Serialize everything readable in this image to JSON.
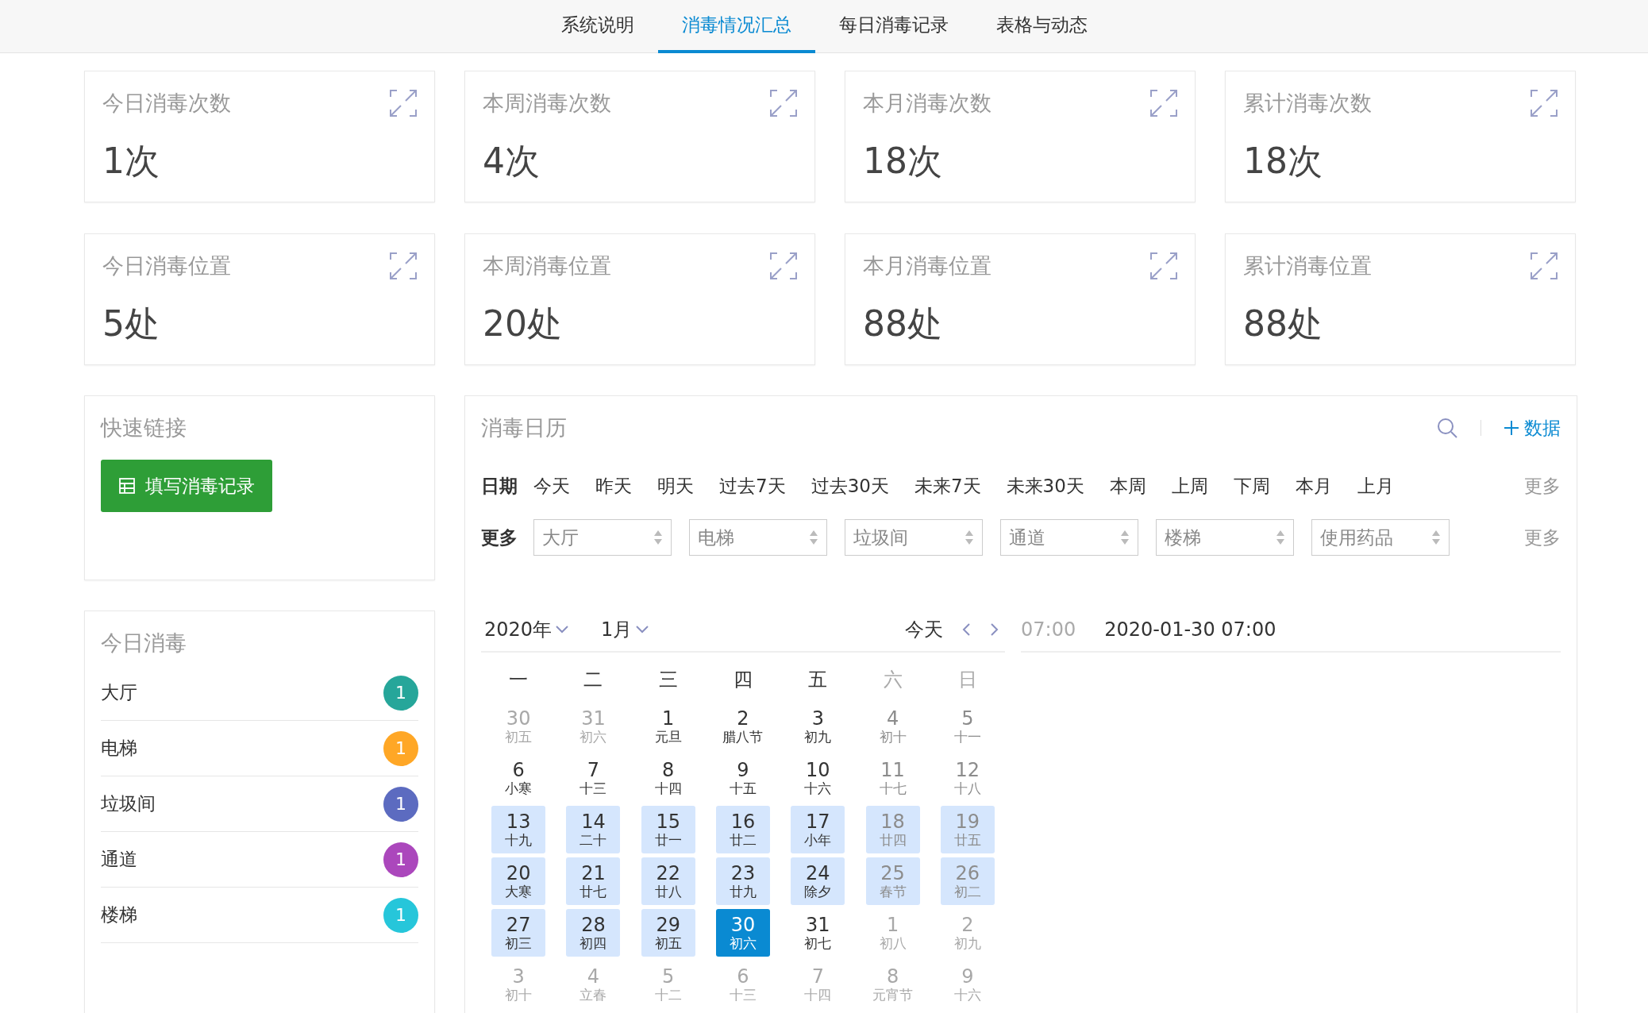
{
  "tabs": [
    {
      "label": "系统说明",
      "selected": false
    },
    {
      "label": "消毒情况汇总",
      "selected": true
    },
    {
      "label": "每日消毒记录",
      "selected": false
    },
    {
      "label": "表格与动态",
      "selected": false
    }
  ],
  "stats": [
    {
      "title": "今日消毒次数",
      "value": "1次"
    },
    {
      "title": "本周消毒次数",
      "value": "4次"
    },
    {
      "title": "本月消毒次数",
      "value": "18次"
    },
    {
      "title": "累计消毒次数",
      "value": "18次"
    },
    {
      "title": "今日消毒位置",
      "value": "5处"
    },
    {
      "title": "本周消毒位置",
      "value": "20处"
    },
    {
      "title": "本月消毒位置",
      "value": "88处"
    },
    {
      "title": "累计消毒位置",
      "value": "88处"
    }
  ],
  "quick_links": {
    "title": "快速链接",
    "button": "填写消毒记录"
  },
  "today": {
    "title": "今日消毒",
    "items": [
      {
        "name": "大厅",
        "count": "1",
        "color": "#26a69a"
      },
      {
        "name": "电梯",
        "count": "1",
        "color": "#ffa726"
      },
      {
        "name": "垃圾间",
        "count": "1",
        "color": "#5c6bc0"
      },
      {
        "name": "通道",
        "count": "1",
        "color": "#ab47bc"
      },
      {
        "name": "楼梯",
        "count": "1",
        "color": "#26c6da"
      }
    ]
  },
  "calendar_panel": {
    "title": "消毒日历",
    "add_link": "数据",
    "date_filter": {
      "label": "日期",
      "options": [
        "今天",
        "昨天",
        "明天",
        "过去7天",
        "过去30天",
        "未来7天",
        "未来30天",
        "本周",
        "上周",
        "下周",
        "本月",
        "上月"
      ],
      "more": "更多"
    },
    "select_filter": {
      "label": "更多",
      "selects": [
        {
          "placeholder": "大厅"
        },
        {
          "placeholder": "电梯"
        },
        {
          "placeholder": "垃圾间"
        },
        {
          "placeholder": "通道"
        },
        {
          "placeholder": "楼梯"
        },
        {
          "placeholder": "使用药品"
        }
      ],
      "more": "更多"
    },
    "year": "2020年",
    "month": "1月",
    "today_button": "今天",
    "weekdays": [
      {
        "label": "一",
        "weekend": false
      },
      {
        "label": "二",
        "weekend": false
      },
      {
        "label": "三",
        "weekend": false
      },
      {
        "label": "四",
        "weekend": false
      },
      {
        "label": "五",
        "weekend": false
      },
      {
        "label": "六",
        "weekend": true
      },
      {
        "label": "日",
        "weekend": true
      }
    ],
    "days": [
      {
        "num": "30",
        "lunar": "初五",
        "kind": "outside",
        "highlighted": false,
        "selected": false
      },
      {
        "num": "31",
        "lunar": "初六",
        "kind": "outside",
        "highlighted": false,
        "selected": false
      },
      {
        "num": "1",
        "lunar": "元旦",
        "kind": "weekday",
        "highlighted": false,
        "selected": false
      },
      {
        "num": "2",
        "lunar": "腊八节",
        "kind": "weekday",
        "highlighted": false,
        "selected": false
      },
      {
        "num": "3",
        "lunar": "初九",
        "kind": "weekday",
        "highlighted": false,
        "selected": false
      },
      {
        "num": "4",
        "lunar": "初十",
        "kind": "weekend",
        "highlighted": false,
        "selected": false
      },
      {
        "num": "5",
        "lunar": "十一",
        "kind": "weekend",
        "highlighted": false,
        "selected": false
      },
      {
        "num": "6",
        "lunar": "小寒",
        "kind": "weekday",
        "highlighted": false,
        "selected": false
      },
      {
        "num": "7",
        "lunar": "十三",
        "kind": "weekday",
        "highlighted": false,
        "selected": false
      },
      {
        "num": "8",
        "lunar": "十四",
        "kind": "weekday",
        "highlighted": false,
        "selected": false
      },
      {
        "num": "9",
        "lunar": "十五",
        "kind": "weekday",
        "highlighted": false,
        "selected": false
      },
      {
        "num": "10",
        "lunar": "十六",
        "kind": "weekday",
        "highlighted": false,
        "selected": false
      },
      {
        "num": "11",
        "lunar": "十七",
        "kind": "weekend",
        "highlighted": false,
        "selected": false
      },
      {
        "num": "12",
        "lunar": "十八",
        "kind": "weekend",
        "highlighted": false,
        "selected": false
      },
      {
        "num": "13",
        "lunar": "十九",
        "kind": "weekday",
        "highlighted": true,
        "selected": false
      },
      {
        "num": "14",
        "lunar": "二十",
        "kind": "weekday",
        "highlighted": true,
        "selected": false
      },
      {
        "num": "15",
        "lunar": "廿一",
        "kind": "weekday",
        "highlighted": true,
        "selected": false
      },
      {
        "num": "16",
        "lunar": "廿二",
        "kind": "weekday",
        "highlighted": true,
        "selected": false
      },
      {
        "num": "17",
        "lunar": "小年",
        "kind": "weekday",
        "highlighted": true,
        "selected": false
      },
      {
        "num": "18",
        "lunar": "廿四",
        "kind": "weekend",
        "highlighted": true,
        "selected": false
      },
      {
        "num": "19",
        "lunar": "廿五",
        "kind": "weekend",
        "highlighted": true,
        "selected": false
      },
      {
        "num": "20",
        "lunar": "大寒",
        "kind": "weekday",
        "highlighted": true,
        "selected": false
      },
      {
        "num": "21",
        "lunar": "廿七",
        "kind": "weekday",
        "highlighted": true,
        "selected": false
      },
      {
        "num": "22",
        "lunar": "廿八",
        "kind": "weekday",
        "highlighted": true,
        "selected": false
      },
      {
        "num": "23",
        "lunar": "廿九",
        "kind": "weekday",
        "highlighted": true,
        "selected": false
      },
      {
        "num": "24",
        "lunar": "除夕",
        "kind": "weekday",
        "highlighted": true,
        "selected": false
      },
      {
        "num": "25",
        "lunar": "春节",
        "kind": "weekend",
        "highlighted": true,
        "selected": false
      },
      {
        "num": "26",
        "lunar": "初二",
        "kind": "weekend",
        "highlighted": true,
        "selected": false
      },
      {
        "num": "27",
        "lunar": "初三",
        "kind": "weekday",
        "highlighted": true,
        "selected": false
      },
      {
        "num": "28",
        "lunar": "初四",
        "kind": "weekday",
        "highlighted": true,
        "selected": false
      },
      {
        "num": "29",
        "lunar": "初五",
        "kind": "weekday",
        "highlighted": true,
        "selected": false
      },
      {
        "num": "30",
        "lunar": "初六",
        "kind": "weekday",
        "highlighted": false,
        "selected": true
      },
      {
        "num": "31",
        "lunar": "初七",
        "kind": "weekday",
        "highlighted": false,
        "selected": false
      },
      {
        "num": "1",
        "lunar": "初八",
        "kind": "outside",
        "highlighted": false,
        "selected": false
      },
      {
        "num": "2",
        "lunar": "初九",
        "kind": "outside",
        "highlighted": false,
        "selected": false
      },
      {
        "num": "3",
        "lunar": "初十",
        "kind": "outside",
        "highlighted": false,
        "selected": false
      },
      {
        "num": "4",
        "lunar": "立春",
        "kind": "outside",
        "highlighted": false,
        "selected": false
      },
      {
        "num": "5",
        "lunar": "十二",
        "kind": "outside",
        "highlighted": false,
        "selected": false
      },
      {
        "num": "6",
        "lunar": "十三",
        "kind": "outside",
        "highlighted": false,
        "selected": false
      },
      {
        "num": "7",
        "lunar": "十四",
        "kind": "outside",
        "highlighted": false,
        "selected": false
      },
      {
        "num": "8",
        "lunar": "元宵节",
        "kind": "outside",
        "highlighted": false,
        "selected": false
      },
      {
        "num": "9",
        "lunar": "十六",
        "kind": "outside",
        "highlighted": false,
        "selected": false
      }
    ],
    "event_time": "07:00",
    "event_datetime": "2020-01-30 07:00"
  }
}
